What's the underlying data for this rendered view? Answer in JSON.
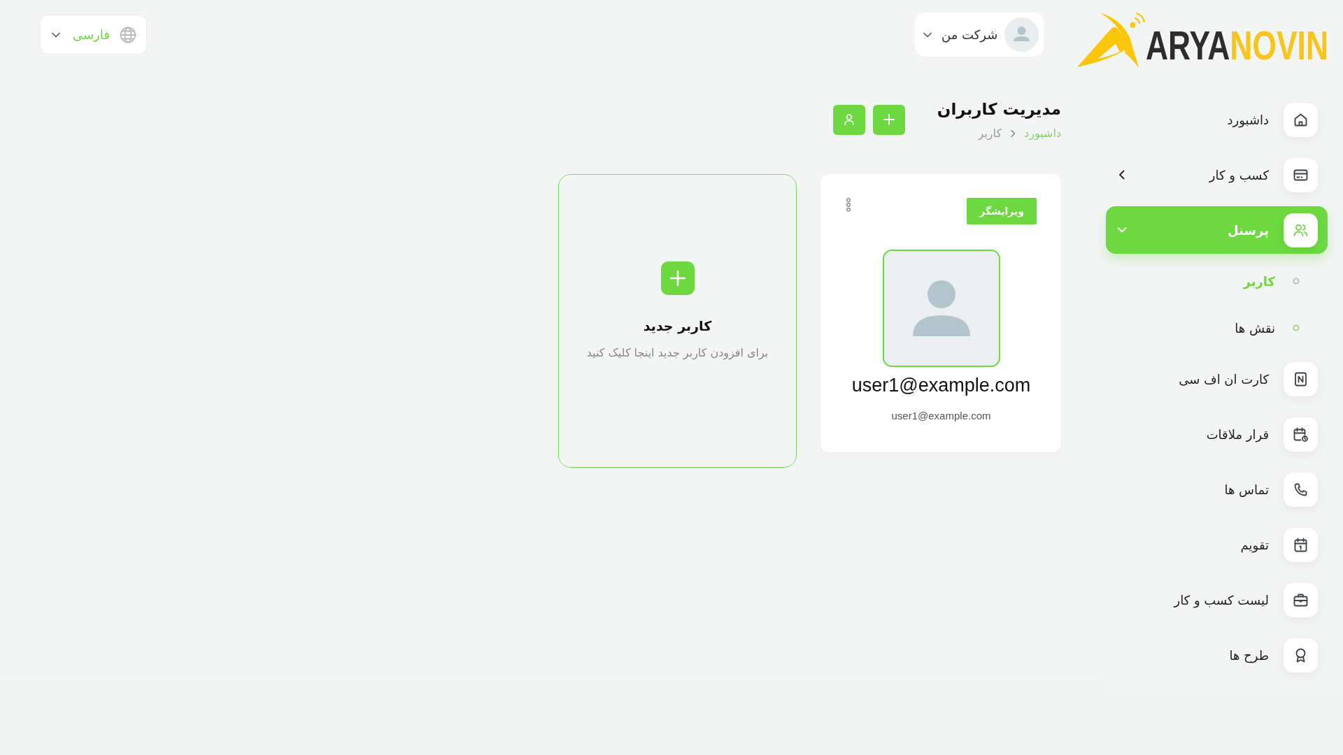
{
  "header": {
    "logo": {
      "dark_part": "ARYA",
      "accent_part": "NOVIN"
    },
    "company_menu": {
      "label": "شرکت من"
    },
    "language_menu": {
      "label": "فارسی"
    }
  },
  "sidebar": {
    "items": [
      {
        "label": "داشبورد",
        "selected": false
      },
      {
        "label": "کسب و کار",
        "selected": false,
        "expanded": false
      },
      {
        "label": "پرسنل",
        "selected": true,
        "expanded": true,
        "children": [
          {
            "label": "کاربر",
            "selected": true
          },
          {
            "label": "نقش ها",
            "selected": false
          }
        ]
      },
      {
        "label": "کارت ان اف سی",
        "selected": false
      },
      {
        "label": "قرار ملاقات",
        "selected": false
      },
      {
        "label": "تماس ها",
        "selected": false
      },
      {
        "label": "تقویم",
        "selected": false
      },
      {
        "label": "لیست کسب و کار",
        "selected": false
      },
      {
        "label": "طرح ها",
        "selected": false
      }
    ]
  },
  "page": {
    "title": "مدیریت کاربران",
    "breadcrumb": [
      {
        "label": "داشبورد",
        "kind": "link"
      },
      {
        "label": "کاربر",
        "kind": "current"
      }
    ]
  },
  "users": [
    {
      "name": "user1@example.com",
      "email": "user1@example.com",
      "role": "ویرایشگر"
    }
  ],
  "new_user_card": {
    "title": "کاربر جدید",
    "description": "برای افزودن کاربر جدید اینجا کلیک کنید"
  }
}
